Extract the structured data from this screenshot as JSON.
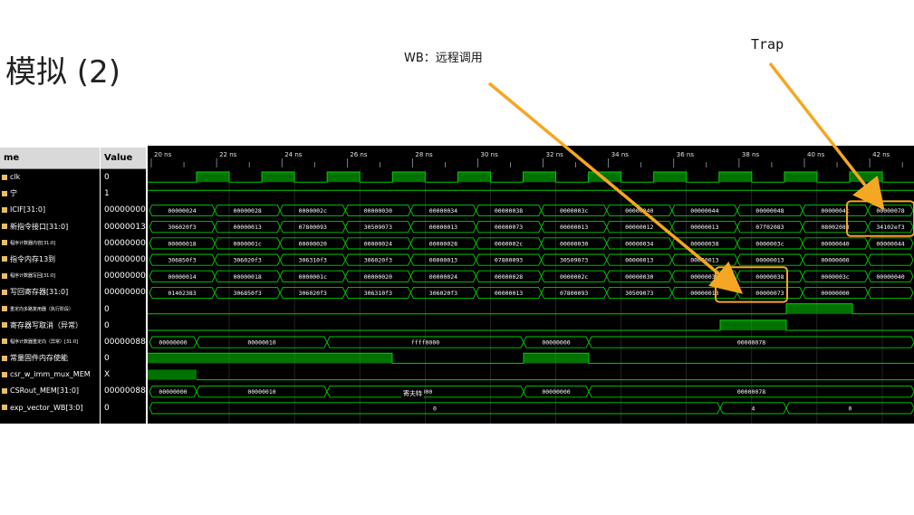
{
  "slide": {
    "title": "模拟 (2)",
    "callouts": {
      "wb": "WB：远程调用",
      "trap": "Trap"
    }
  },
  "panel": {
    "headers": {
      "name": "me",
      "value": "Value"
    },
    "signals": [
      {
        "name": "clk",
        "value": "0",
        "tiny": false
      },
      {
        "name": "宁",
        "value": "1",
        "tiny": false
      },
      {
        "name": "ICIF[31:0]",
        "value": "00000000",
        "tiny": false
      },
      {
        "name": "新指令接口[31:0]",
        "value": "00000013",
        "tiny": false
      },
      {
        "name": "程序计数器内容[31:0]",
        "value": "00000000",
        "tiny": true
      },
      {
        "name": "指令内存13到",
        "value": "00000000",
        "tiny": false
      },
      {
        "name": "程序计数器写回[31:0]",
        "value": "00000000",
        "tiny": true
      },
      {
        "name": "写回寄存器[31:0]",
        "value": "00000000",
        "tiny": false
      },
      {
        "name": "重定向多路复用器（执行阶段）",
        "value": "0",
        "tiny": true
      },
      {
        "name": "寄存器写取消（异常）",
        "value": "0",
        "tiny": false
      },
      {
        "name": "程序计数器重定向（异常）[31:0]",
        "value": "00000088",
        "tiny": true
      },
      {
        "name": "常量固件内存使能",
        "value": "0",
        "tiny": false
      },
      {
        "name": "csr_w_imm_mux_MEM",
        "value": "X",
        "tiny": false
      },
      {
        "name": "CSRout_MEM[31:0]",
        "value": "00000088",
        "tiny": false
      },
      {
        "name": "exp_vector_WB[3:0]",
        "value": "0",
        "tiny": false
      }
    ]
  },
  "waveform": {
    "time_labels": [
      "20 ns",
      "22 ns",
      "24 ns",
      "26 ns",
      "28 ns",
      "30 ns",
      "32 ns",
      "34 ns",
      "36 ns",
      "38 ns",
      "40 ns",
      "42 ns"
    ],
    "bus_rows": [
      [
        "00000024",
        "00000028",
        "0000002c",
        "00000030",
        "00000034",
        "00000038",
        "0000003c",
        "00000040",
        "00000044",
        "00000048",
        "0000004c",
        "00000078"
      ],
      [
        "306020f3",
        "00000013",
        "07800093",
        "30509073",
        "00000013",
        "00000073",
        "00000013",
        "00000012",
        "00000013",
        "07f02083",
        "08002083",
        "34102ef3"
      ],
      [
        "00000018",
        "0000001c",
        "00000020",
        "00000024",
        "00000028",
        "0000002c",
        "00000030",
        "00000034",
        "00000038",
        "0000003c",
        "00000040",
        "00000044"
      ],
      [
        "306850f3",
        "306020f3",
        "306310f3",
        "306020f3",
        "00000013",
        "07800093",
        "30509073",
        "00000013",
        "00000013",
        "00000013",
        "00000000",
        ""
      ],
      [
        "00000014",
        "00000018",
        "0000001c",
        "00000020",
        "00000024",
        "00000028",
        "0000002c",
        "00000030",
        "00000034",
        "00000038",
        "0000003c",
        "00000040"
      ],
      [
        "01402383",
        "306850f3",
        "306020f3",
        "306310f3",
        "306020f3",
        "00000013",
        "07800093",
        "30509073",
        "00000013",
        "00000073",
        "00000000",
        ""
      ]
    ],
    "redirect_row": [
      "00000000",
      "00000010",
      "ffff0000",
      "00000000",
      "00000078"
    ],
    "csrout_row": [
      "00000000",
      "00000010",
      "0000",
      "00000000",
      "00000078"
    ],
    "exp_vector_row": [
      "0",
      "4",
      "0"
    ],
    "tooltip": "寄夫特"
  },
  "colors": {
    "wave": "#00d000",
    "highlight": "#f5a623",
    "background": "#000000"
  }
}
